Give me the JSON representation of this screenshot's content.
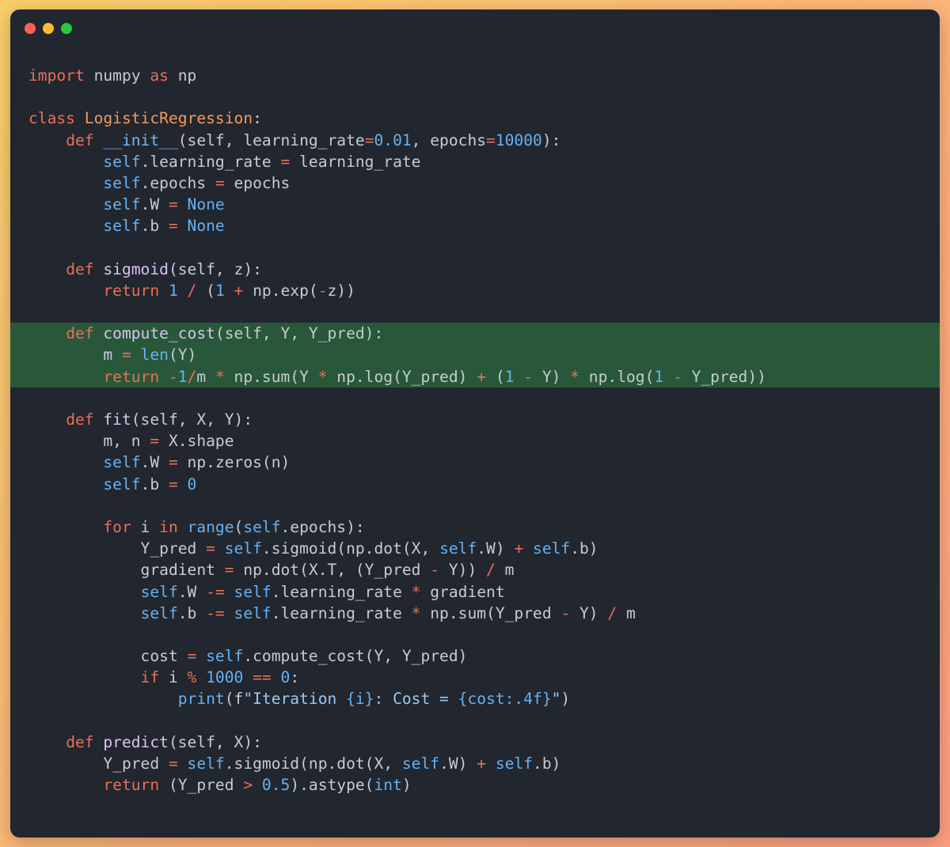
{
  "window": {
    "controls": [
      {
        "name": "close-button",
        "color": "#ff5f57"
      },
      {
        "name": "minimize-button",
        "color": "#febc2e"
      },
      {
        "name": "maximize-button",
        "color": "#28c840"
      }
    ]
  },
  "code": {
    "highlighted_lines": [
      12,
      13,
      14
    ],
    "lines": [
      [
        [
          "kw",
          "import"
        ],
        [
          "plain",
          " numpy "
        ],
        [
          "kw",
          "as"
        ],
        [
          "plain",
          " np"
        ]
      ],
      [],
      [
        [
          "kw",
          "class"
        ],
        [
          "plain",
          " "
        ],
        [
          "cls",
          "LogisticRegression"
        ],
        [
          "plain",
          ":"
        ]
      ],
      [
        [
          "plain",
          "    "
        ],
        [
          "kw",
          "def"
        ],
        [
          "plain",
          " "
        ],
        [
          "magic",
          "__init__"
        ],
        [
          "plain",
          "(self, learning_rate"
        ],
        [
          "op",
          "="
        ],
        [
          "num",
          "0.01"
        ],
        [
          "plain",
          ", epochs"
        ],
        [
          "op",
          "="
        ],
        [
          "num",
          "10000"
        ],
        [
          "plain",
          "):"
        ]
      ],
      [
        [
          "plain",
          "        "
        ],
        [
          "selfk",
          "self"
        ],
        [
          "plain",
          ".learning_rate "
        ],
        [
          "op",
          "="
        ],
        [
          "plain",
          " learning_rate"
        ]
      ],
      [
        [
          "plain",
          "        "
        ],
        [
          "selfk",
          "self"
        ],
        [
          "plain",
          ".epochs "
        ],
        [
          "op",
          "="
        ],
        [
          "plain",
          " epochs"
        ]
      ],
      [
        [
          "plain",
          "        "
        ],
        [
          "selfk",
          "self"
        ],
        [
          "plain",
          ".W "
        ],
        [
          "op",
          "="
        ],
        [
          "plain",
          " "
        ],
        [
          "num",
          "None"
        ]
      ],
      [
        [
          "plain",
          "        "
        ],
        [
          "selfk",
          "self"
        ],
        [
          "plain",
          ".b "
        ],
        [
          "op",
          "="
        ],
        [
          "plain",
          " "
        ],
        [
          "num",
          "None"
        ]
      ],
      [],
      [
        [
          "plain",
          "    "
        ],
        [
          "kw",
          "def"
        ],
        [
          "plain",
          " "
        ],
        [
          "fn",
          "sigmoid"
        ],
        [
          "plain",
          "(self, z):"
        ]
      ],
      [
        [
          "plain",
          "        "
        ],
        [
          "kw",
          "return"
        ],
        [
          "plain",
          " "
        ],
        [
          "num",
          "1"
        ],
        [
          "plain",
          " "
        ],
        [
          "op",
          "/"
        ],
        [
          "plain",
          " ("
        ],
        [
          "num",
          "1"
        ],
        [
          "plain",
          " "
        ],
        [
          "op",
          "+"
        ],
        [
          "plain",
          " np.exp("
        ],
        [
          "op",
          "-"
        ],
        [
          "plain",
          "z))"
        ]
      ],
      [],
      [
        [
          "plain",
          "    "
        ],
        [
          "kw",
          "def"
        ],
        [
          "plain",
          " "
        ],
        [
          "fn",
          "compute_cost"
        ],
        [
          "plain",
          "(self, Y, Y_pred):"
        ]
      ],
      [
        [
          "plain",
          "        m "
        ],
        [
          "op",
          "="
        ],
        [
          "plain",
          " "
        ],
        [
          "builtin",
          "len"
        ],
        [
          "plain",
          "(Y)"
        ]
      ],
      [
        [
          "plain",
          "        "
        ],
        [
          "kw",
          "return"
        ],
        [
          "plain",
          " "
        ],
        [
          "op",
          "-"
        ],
        [
          "num",
          "1"
        ],
        [
          "op",
          "/"
        ],
        [
          "plain",
          "m "
        ],
        [
          "op",
          "*"
        ],
        [
          "plain",
          " np.sum(Y "
        ],
        [
          "op",
          "*"
        ],
        [
          "plain",
          " np.log(Y_pred) "
        ],
        [
          "op",
          "+"
        ],
        [
          "plain",
          " ("
        ],
        [
          "num",
          "1"
        ],
        [
          "plain",
          " "
        ],
        [
          "op",
          "-"
        ],
        [
          "plain",
          " Y) "
        ],
        [
          "op",
          "*"
        ],
        [
          "plain",
          " np.log("
        ],
        [
          "num",
          "1"
        ],
        [
          "plain",
          " "
        ],
        [
          "op",
          "-"
        ],
        [
          "plain",
          " Y_pred))"
        ]
      ],
      [],
      [
        [
          "plain",
          "    "
        ],
        [
          "kw",
          "def"
        ],
        [
          "plain",
          " "
        ],
        [
          "fn",
          "fit"
        ],
        [
          "plain",
          "(self, X, Y):"
        ]
      ],
      [
        [
          "plain",
          "        m, n "
        ],
        [
          "op",
          "="
        ],
        [
          "plain",
          " X.shape"
        ]
      ],
      [
        [
          "plain",
          "        "
        ],
        [
          "selfk",
          "self"
        ],
        [
          "plain",
          ".W "
        ],
        [
          "op",
          "="
        ],
        [
          "plain",
          " np.zeros(n)"
        ]
      ],
      [
        [
          "plain",
          "        "
        ],
        [
          "selfk",
          "self"
        ],
        [
          "plain",
          ".b "
        ],
        [
          "op",
          "="
        ],
        [
          "plain",
          " "
        ],
        [
          "num",
          "0"
        ]
      ],
      [],
      [
        [
          "plain",
          "        "
        ],
        [
          "kw",
          "for"
        ],
        [
          "plain",
          " i "
        ],
        [
          "kw",
          "in"
        ],
        [
          "plain",
          " "
        ],
        [
          "builtin",
          "range"
        ],
        [
          "plain",
          "("
        ],
        [
          "selfk",
          "self"
        ],
        [
          "plain",
          ".epochs):"
        ]
      ],
      [
        [
          "plain",
          "            Y_pred "
        ],
        [
          "op",
          "="
        ],
        [
          "plain",
          " "
        ],
        [
          "selfk",
          "self"
        ],
        [
          "plain",
          ".sigmoid(np.dot(X, "
        ],
        [
          "selfk",
          "self"
        ],
        [
          "plain",
          ".W) "
        ],
        [
          "op",
          "+"
        ],
        [
          "plain",
          " "
        ],
        [
          "selfk",
          "self"
        ],
        [
          "plain",
          ".b)"
        ]
      ],
      [
        [
          "plain",
          "            gradient "
        ],
        [
          "op",
          "="
        ],
        [
          "plain",
          " np.dot(X.T, (Y_pred "
        ],
        [
          "op",
          "-"
        ],
        [
          "plain",
          " Y)) "
        ],
        [
          "op",
          "/"
        ],
        [
          "plain",
          " m"
        ]
      ],
      [
        [
          "plain",
          "            "
        ],
        [
          "selfk",
          "self"
        ],
        [
          "plain",
          ".W "
        ],
        [
          "op",
          "-="
        ],
        [
          "plain",
          " "
        ],
        [
          "selfk",
          "self"
        ],
        [
          "plain",
          ".learning_rate "
        ],
        [
          "op",
          "*"
        ],
        [
          "plain",
          " gradient"
        ]
      ],
      [
        [
          "plain",
          "            "
        ],
        [
          "selfk",
          "self"
        ],
        [
          "plain",
          ".b "
        ],
        [
          "op",
          "-="
        ],
        [
          "plain",
          " "
        ],
        [
          "selfk",
          "self"
        ],
        [
          "plain",
          ".learning_rate "
        ],
        [
          "op",
          "*"
        ],
        [
          "plain",
          " np.sum(Y_pred "
        ],
        [
          "op",
          "-"
        ],
        [
          "plain",
          " Y) "
        ],
        [
          "op",
          "/"
        ],
        [
          "plain",
          " m"
        ]
      ],
      [],
      [
        [
          "plain",
          "            cost "
        ],
        [
          "op",
          "="
        ],
        [
          "plain",
          " "
        ],
        [
          "selfk",
          "self"
        ],
        [
          "plain",
          ".compute_cost(Y, Y_pred)"
        ]
      ],
      [
        [
          "plain",
          "            "
        ],
        [
          "kw",
          "if"
        ],
        [
          "plain",
          " i "
        ],
        [
          "op",
          "%"
        ],
        [
          "plain",
          " "
        ],
        [
          "num",
          "1000"
        ],
        [
          "plain",
          " "
        ],
        [
          "op",
          "=="
        ],
        [
          "plain",
          " "
        ],
        [
          "num",
          "0"
        ],
        [
          "plain",
          ":"
        ]
      ],
      [
        [
          "plain",
          "                "
        ],
        [
          "builtin",
          "print"
        ],
        [
          "plain",
          "(f"
        ],
        [
          "str",
          "\"Iteration "
        ],
        [
          "num",
          "{i}"
        ],
        [
          "str",
          ": Cost = "
        ],
        [
          "num",
          "{cost:.4f}"
        ],
        [
          "str",
          "\""
        ],
        [
          "plain",
          ")"
        ]
      ],
      [],
      [
        [
          "plain",
          "    "
        ],
        [
          "kw",
          "def"
        ],
        [
          "plain",
          " "
        ],
        [
          "fn",
          "predict"
        ],
        [
          "plain",
          "(self, X):"
        ]
      ],
      [
        [
          "plain",
          "        Y_pred "
        ],
        [
          "op",
          "="
        ],
        [
          "plain",
          " "
        ],
        [
          "selfk",
          "self"
        ],
        [
          "plain",
          ".sigmoid(np.dot(X, "
        ],
        [
          "selfk",
          "self"
        ],
        [
          "plain",
          ".W) "
        ],
        [
          "op",
          "+"
        ],
        [
          "plain",
          " "
        ],
        [
          "selfk",
          "self"
        ],
        [
          "plain",
          ".b)"
        ]
      ],
      [
        [
          "plain",
          "        "
        ],
        [
          "kw",
          "return"
        ],
        [
          "plain",
          " (Y_pred "
        ],
        [
          "op",
          ">"
        ],
        [
          "plain",
          " "
        ],
        [
          "num",
          "0.5"
        ],
        [
          "plain",
          ").astype("
        ],
        [
          "builtin",
          "int"
        ],
        [
          "plain",
          ")"
        ]
      ]
    ]
  }
}
